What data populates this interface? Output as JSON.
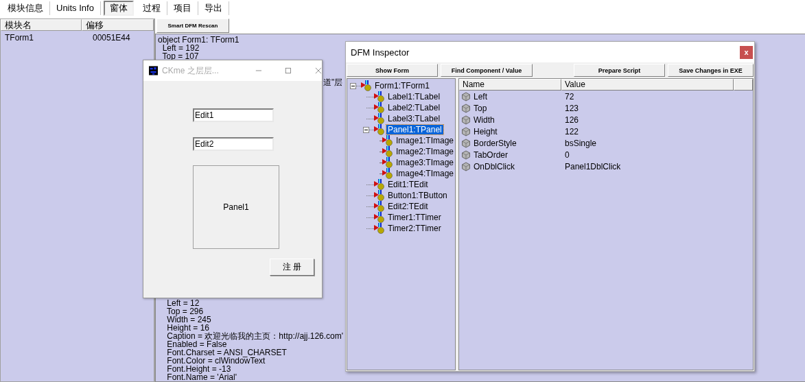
{
  "tabs": [
    {
      "label": "模块信息",
      "selected": false
    },
    {
      "label": "Units Info",
      "selected": false
    },
    {
      "label": "窗体",
      "selected": true
    },
    {
      "label": "过程",
      "selected": false
    },
    {
      "label": "项目",
      "selected": false
    },
    {
      "label": "导出",
      "selected": false
    }
  ],
  "modules": {
    "columns": [
      "模块名",
      "偏移"
    ],
    "rows": [
      [
        "TForm1",
        "00051E44"
      ]
    ]
  },
  "rescan_button": "Smart DFM Rescan",
  "dfm_text": {
    "top_lines": [
      "object Form1: TForm1",
      "  Left = 192",
      "  Top = 107"
    ],
    "fragment": "道\"层",
    "bottom_lines": [
      "    Left = 12",
      "    Top = 296",
      "    Width = 245",
      "    Height = 16",
      "    Caption = 欢迎光临我的主页：http://ajj.126.com'",
      "    Enabled = False",
      "    Font.Charset = ANSI_CHARSET",
      "    Font.Color = clWindowText",
      "    Font.Height = -13",
      "    Font.Name = 'Arial'"
    ]
  },
  "form_window": {
    "title": "CKme 之层层...",
    "active": false,
    "edits": [
      "Edit1",
      "Edit2"
    ],
    "panel": "Panel1",
    "button": "注 册"
  },
  "inspector": {
    "title": "DFM Inspector",
    "close": "x",
    "buttons_left": [
      "Show Form",
      "Find Component / Value"
    ],
    "buttons_right": [
      "Prepare Script",
      "Save Changes in EXE"
    ],
    "tree": [
      {
        "label": "Form1:TForm1",
        "expanded": true,
        "selected": false,
        "children": [
          {
            "label": "Label1:TLabel",
            "selected": false
          },
          {
            "label": "Label2:TLabel",
            "selected": false
          },
          {
            "label": "Label3:TLabel",
            "selected": false
          },
          {
            "label": "Panel1:TPanel",
            "expanded": true,
            "selected": true,
            "children": [
              {
                "label": "Image1:TImage",
                "selected": false
              },
              {
                "label": "Image2:TImage",
                "selected": false
              },
              {
                "label": "Image3:TImage",
                "selected": false
              },
              {
                "label": "Image4:TImage",
                "selected": false
              }
            ]
          },
          {
            "label": "Edit1:TEdit",
            "selected": false
          },
          {
            "label": "Button1:TButton",
            "selected": false
          },
          {
            "label": "Edit2:TEdit",
            "selected": false
          },
          {
            "label": "Timer1:TTimer",
            "selected": false
          },
          {
            "label": "Timer2:TTimer",
            "selected": false
          }
        ]
      }
    ],
    "columns": [
      "Name",
      "Value"
    ],
    "properties": [
      {
        "name": "Left",
        "value": "72"
      },
      {
        "name": "Top",
        "value": "123"
      },
      {
        "name": "Width",
        "value": "126"
      },
      {
        "name": "Height",
        "value": "122"
      },
      {
        "name": "BorderStyle",
        "value": "bsSingle"
      },
      {
        "name": "TabOrder",
        "value": "0"
      },
      {
        "name": "OnDblClick",
        "value": "Panel1DblClick"
      }
    ]
  }
}
